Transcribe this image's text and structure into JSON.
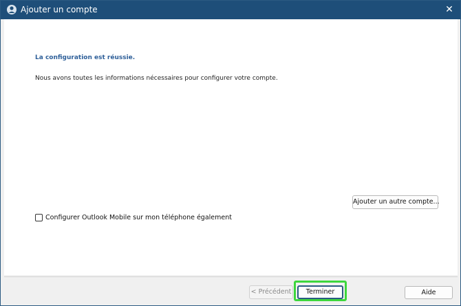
{
  "window": {
    "title": "Ajouter un compte",
    "close_glyph": "✕"
  },
  "content": {
    "heading": "La configuration est réussie.",
    "message": "Nous avons toutes les informations nécessaires pour configurer votre compte.",
    "mobile_checkbox": {
      "label": "Configurer Outlook Mobile sur mon téléphone également",
      "checked": false
    },
    "add_account_label": "Ajouter un autre compte..."
  },
  "footer": {
    "previous_label": "< Précédent",
    "finish_label": "Terminer",
    "help_label": "Aide"
  },
  "colors": {
    "titlebar": "#1e4e79",
    "heading": "#2e5f99",
    "highlight": "#3dd63d"
  },
  "icons": {
    "app": "outlook-account-icon",
    "close": "close-icon"
  }
}
